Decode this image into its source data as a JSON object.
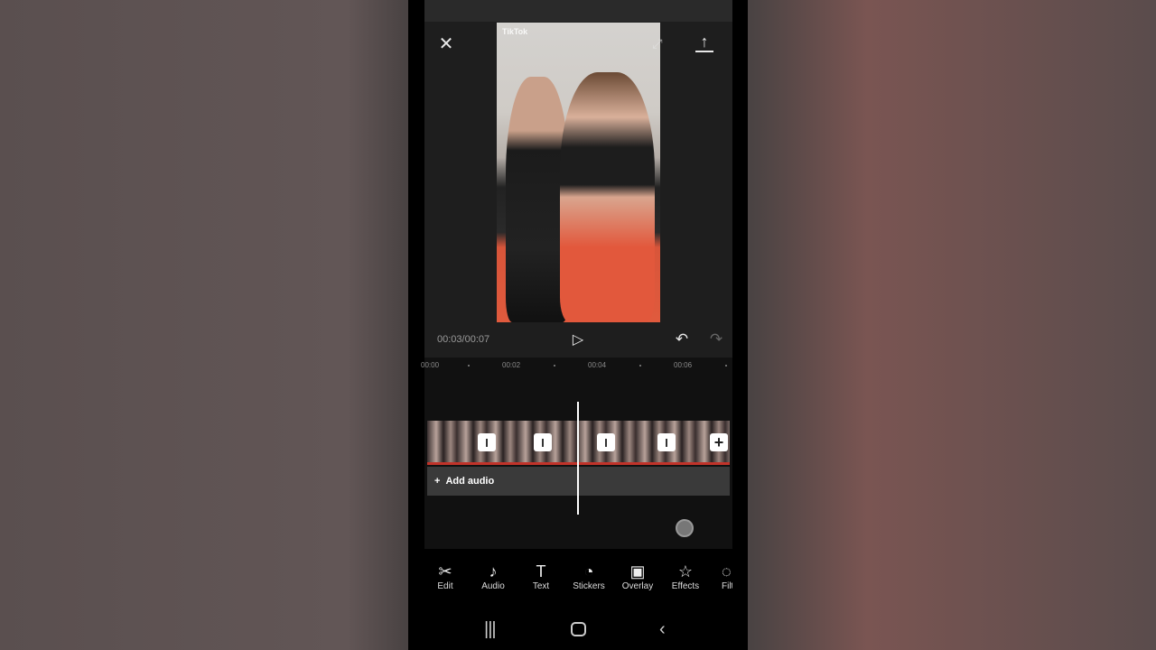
{
  "preview": {
    "watermark": "TikTok"
  },
  "player": {
    "time": "00:03/00:07",
    "progress_seconds": 3,
    "duration_seconds": 7
  },
  "ruler": [
    "00:00",
    "00:02",
    "00:04",
    "00:06"
  ],
  "timeline": {
    "add_audio": "Add audio"
  },
  "toolbar": [
    {
      "label": "Edit",
      "icon": "scissors-icon"
    },
    {
      "label": "Audio",
      "icon": "music-note-icon"
    },
    {
      "label": "Text",
      "icon": "text-icon"
    },
    {
      "label": "Stickers",
      "icon": "sticker-icon"
    },
    {
      "label": "Overlay",
      "icon": "overlay-icon"
    },
    {
      "label": "Effects",
      "icon": "star-effects-icon"
    },
    {
      "label": "Filters",
      "icon": "filter-icon"
    }
  ]
}
